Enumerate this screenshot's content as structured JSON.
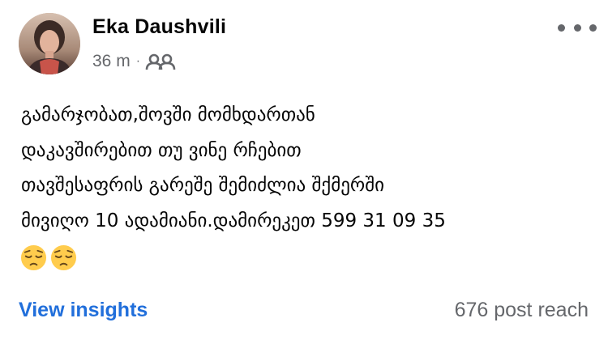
{
  "post": {
    "author": "Eka Daushvili",
    "time": "36 m",
    "separator": "·",
    "audience_icon": "friends-icon",
    "more_icon": "more-horizontal-icon",
    "text": "გამარჯობათ,შოვში მომხდართან\nდაკავშირებით თუ ვინე რჩებით\nთავშესაფრის გარეშე შემიძლია შქმერში\nმივიღო 10 ადამიანი.დამირეკეთ 599 31 09 35",
    "emojis": [
      "pensive-face",
      "pensive-face"
    ]
  },
  "footer": {
    "insights_label": "View insights",
    "reach": "676 post reach"
  },
  "colors": {
    "link": "#216fdb",
    "secondary_text": "#65676b",
    "primary_text": "#050505"
  }
}
